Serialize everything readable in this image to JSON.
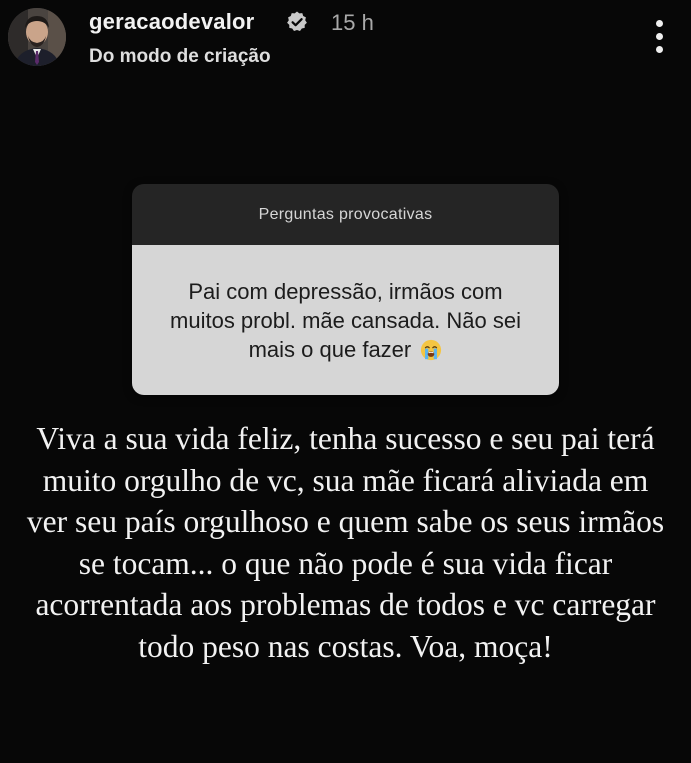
{
  "header": {
    "avatar_icon": "profile-avatar",
    "username": "geracaodevalor",
    "verified_icon": "verified-badge-icon",
    "time": "15 h",
    "subtitle": "Do modo de criação",
    "more_icon": "more-vertical-icon"
  },
  "question_card": {
    "title": "Perguntas provocativas",
    "question": "Pai com depressão, irmãos com muitos probl. mãe cansada. Não sei mais o que fazer",
    "emoji_icon": "loudly-crying-face-emoji"
  },
  "response": {
    "text": "Viva a sua vida feliz, tenha sucesso e seu pai terá muito orgulho de vc, sua mãe ficará aliviada em ver seu país orgulhoso e quem sabe os seus irmãos se tocam... o que não pode é sua vida ficar acorrentada aos problemas de todos e vc carregar todo peso nas costas. Voa, moça!"
  },
  "colors": {
    "background": "#070707",
    "card_header": "#252525",
    "card_body": "#d6d6d6",
    "text_primary": "#f2f2f2",
    "text_muted": "#a9a9a9"
  }
}
